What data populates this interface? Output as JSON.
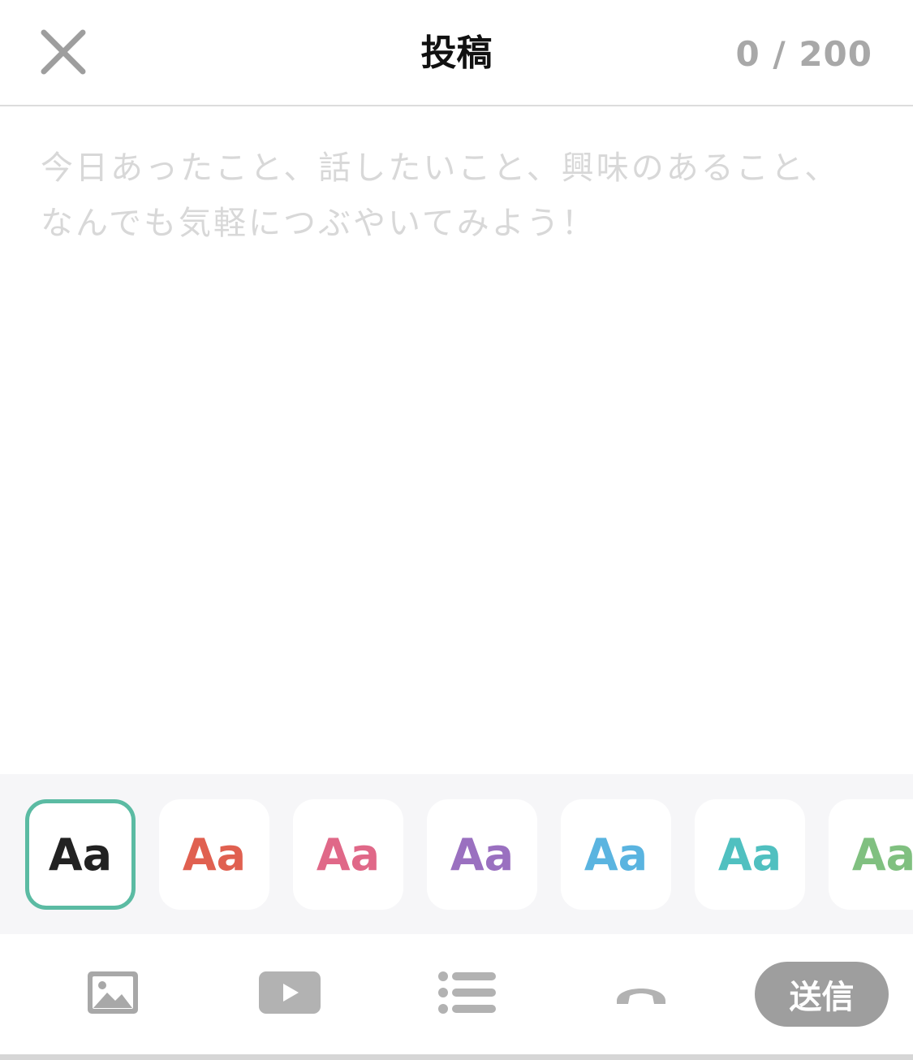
{
  "header": {
    "title": "投稿",
    "char_count": "0 / 200",
    "close_icon": "close-icon"
  },
  "composer": {
    "placeholder": "今日あったこと、話したいこと、興味のあること、なんでも気軽につぶやいてみよう！",
    "value": ""
  },
  "colors": {
    "swatch_label": "Aa",
    "selected_border": "#5bbba3",
    "items": [
      {
        "color": "#222222",
        "selected": true
      },
      {
        "color": "#e06050"
      },
      {
        "color": "#e06888"
      },
      {
        "color": "#9a70c0"
      },
      {
        "color": "#5ab4e0"
      },
      {
        "color": "#50c0c0"
      },
      {
        "color": "#80c080"
      }
    ]
  },
  "toolbar": {
    "icons": [
      "image-icon",
      "video-icon",
      "list-icon",
      "phone-icon"
    ],
    "send_label": "送信"
  }
}
